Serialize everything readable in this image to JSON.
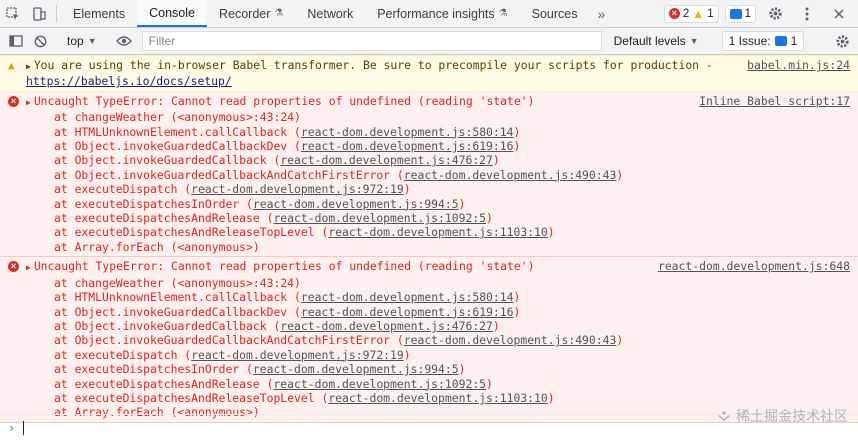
{
  "tabbar": {
    "tabs": [
      {
        "label": "Elements",
        "flask": false
      },
      {
        "label": "Console",
        "flask": false,
        "active": true
      },
      {
        "label": "Recorder",
        "flask": true
      },
      {
        "label": "Network",
        "flask": false
      },
      {
        "label": "Performance insights",
        "flask": true
      },
      {
        "label": "Sources",
        "flask": false
      }
    ],
    "more": "»",
    "errors_count": "2",
    "warnings_count": "1",
    "messages_count": "1"
  },
  "toolbar": {
    "context": "top",
    "filter_placeholder": "Filter",
    "levels": "Default levels",
    "issues_label": "1 Issue:",
    "issues_count": "1"
  },
  "messages": {
    "warning": {
      "text_before_link": "You are using the in-browser Babel transformer. Be sure to precompile your scripts for production - ",
      "link": "https://babeljs.io/docs/setup/",
      "source": "babel.min.js:24"
    },
    "error1": {
      "text": "Uncaught TypeError: Cannot read properties of undefined (reading 'state')",
      "source": "Inline Babel script:17",
      "frames": [
        {
          "fn": "at changeWeather (",
          "loc": "<anonymous>:43:24",
          "end": ")",
          "plain": true
        },
        {
          "fn": "at HTMLUnknownElement.callCallback (",
          "loc": "react-dom.development.js:580:14",
          "end": ")"
        },
        {
          "fn": "at Object.invokeGuardedCallbackDev (",
          "loc": "react-dom.development.js:619:16",
          "end": ")"
        },
        {
          "fn": "at Object.invokeGuardedCallback (",
          "loc": "react-dom.development.js:476:27",
          "end": ")"
        },
        {
          "fn": "at Object.invokeGuardedCallbackAndCatchFirstError (",
          "loc": "react-dom.development.js:490:43",
          "end": ")"
        },
        {
          "fn": "at executeDispatch (",
          "loc": "react-dom.development.js:972:19",
          "end": ")"
        },
        {
          "fn": "at executeDispatchesInOrder (",
          "loc": "react-dom.development.js:994:5",
          "end": ")"
        },
        {
          "fn": "at executeDispatchesAndRelease (",
          "loc": "react-dom.development.js:1092:5",
          "end": ")"
        },
        {
          "fn": "at executeDispatchesAndReleaseTopLevel (",
          "loc": "react-dom.development.js:1103:10",
          "end": ")"
        },
        {
          "fn": "at Array.forEach (",
          "loc": "<anonymous>",
          "end": ")",
          "plain": true
        }
      ]
    },
    "error2": {
      "text": "Uncaught TypeError: Cannot read properties of undefined (reading 'state')",
      "source": "react-dom.development.js:648",
      "frames": [
        {
          "fn": "at changeWeather (",
          "loc": "<anonymous>:43:24",
          "end": ")",
          "plain": true
        },
        {
          "fn": "at HTMLUnknownElement.callCallback (",
          "loc": "react-dom.development.js:580:14",
          "end": ")"
        },
        {
          "fn": "at Object.invokeGuardedCallbackDev (",
          "loc": "react-dom.development.js:619:16",
          "end": ")"
        },
        {
          "fn": "at Object.invokeGuardedCallback (",
          "loc": "react-dom.development.js:476:27",
          "end": ")"
        },
        {
          "fn": "at Object.invokeGuardedCallbackAndCatchFirstError (",
          "loc": "react-dom.development.js:490:43",
          "end": ")"
        },
        {
          "fn": "at executeDispatch (",
          "loc": "react-dom.development.js:972:19",
          "end": ")"
        },
        {
          "fn": "at executeDispatchesInOrder (",
          "loc": "react-dom.development.js:994:5",
          "end": ")"
        },
        {
          "fn": "at executeDispatchesAndRelease (",
          "loc": "react-dom.development.js:1092:5",
          "end": ")"
        },
        {
          "fn": "at executeDispatchesAndReleaseTopLevel (",
          "loc": "react-dom.development.js:1103:10",
          "end": ")"
        },
        {
          "fn": "at Array.forEach (",
          "loc": "<anonymous>",
          "end": ")",
          "plain": true
        }
      ]
    }
  },
  "prompt": {
    "chevron": "›"
  },
  "watermark": "稀土掘金技术社区",
  "colors": {
    "accent": "#1a73e8",
    "error": "#e0261a",
    "error_bg": "#fff0f0",
    "warning_bg": "#fffbe5"
  }
}
